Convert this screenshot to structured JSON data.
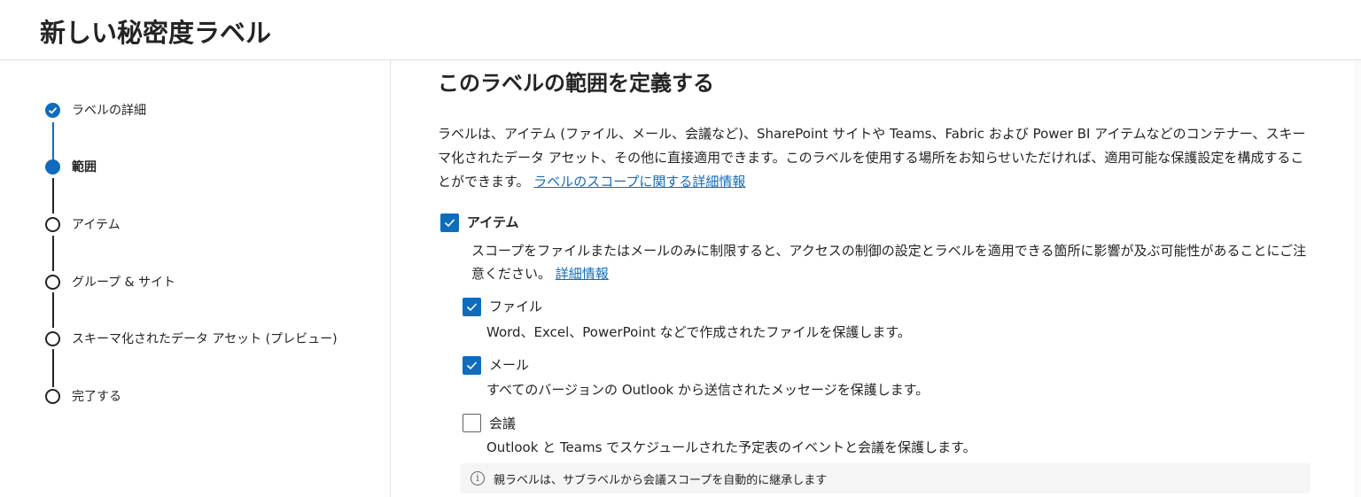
{
  "header": {
    "title": "新しい秘密度ラベル"
  },
  "steps": [
    {
      "label": "ラベルの詳細",
      "state": "complete"
    },
    {
      "label": "範囲",
      "state": "current"
    },
    {
      "label": "アイテム",
      "state": "pending"
    },
    {
      "label": "グループ & サイト",
      "state": "pending"
    },
    {
      "label": "スキーマ化されたデータ アセット (プレビュー)",
      "state": "pending"
    },
    {
      "label": "完了する",
      "state": "pending"
    }
  ],
  "main": {
    "title": "このラベルの範囲を定義する",
    "description": "ラベルは、アイテム (ファイル、メール、会議など)、SharePoint サイトや Teams、Fabric および Power BI アイテムなどのコンテナー、スキーマ化されたデータ アセット、その他に直接適用できます。このラベルを使用する場所をお知らせいただければ、適用可能な保護設定を構成することができます。",
    "description_link": "ラベルのスコープに関する詳細情報",
    "items": {
      "label": "アイテム",
      "checked": true,
      "note": "スコープをファイルまたはメールのみに制限すると、アクセスの制御の設定とラベルを適用できる箇所に影響が及ぶ可能性があることにご注意ください。",
      "note_link": "詳細情報"
    },
    "files": {
      "label": "ファイル",
      "checked": true,
      "description": "Word、Excel、PowerPoint などで作成されたファイルを保護します。"
    },
    "email": {
      "label": "メール",
      "checked": true,
      "description": "すべてのバージョンの Outlook から送信されたメッセージを保護します。"
    },
    "meetings": {
      "label": "会議",
      "checked": false,
      "description": "Outlook と Teams でスケジュールされた予定表のイベントと会議を保護します。"
    },
    "info": {
      "icon": "info-icon",
      "text": "親ラベルは、サブラベルから会議スコープを自動的に継承します"
    }
  },
  "colors": {
    "accent": "#0f6cbd",
    "text": "#242424",
    "info_bg": "#f5f5f5"
  }
}
